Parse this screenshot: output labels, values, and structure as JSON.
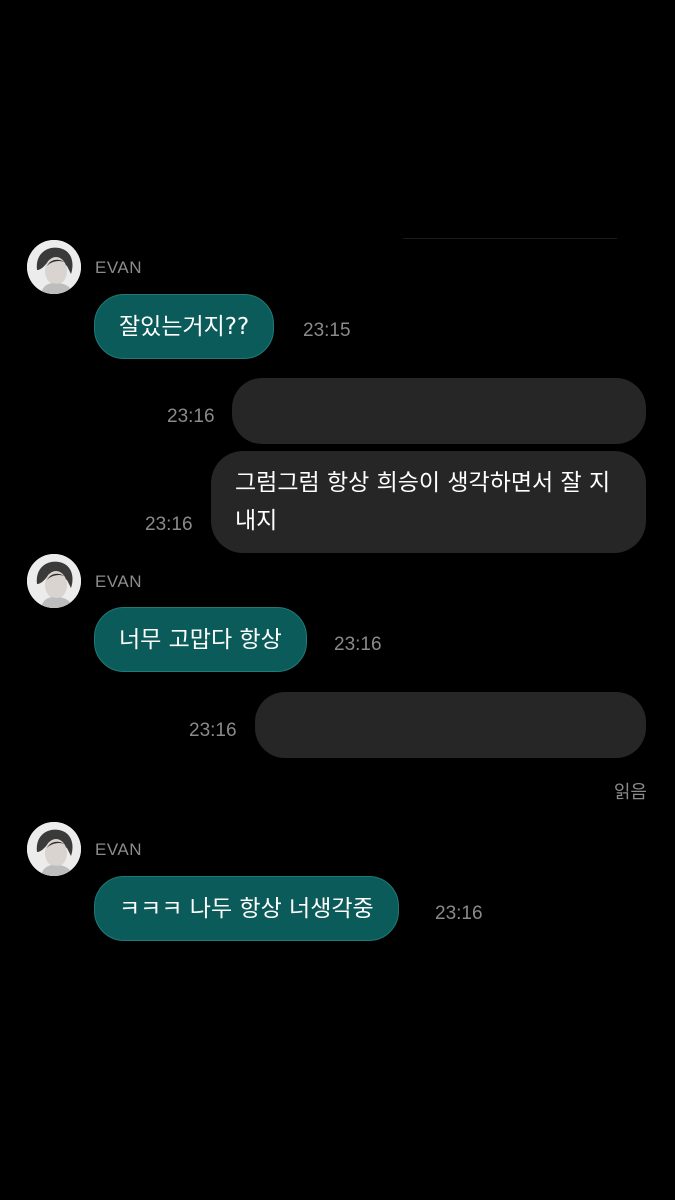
{
  "messages": {
    "m1": {
      "sender": "EVAN",
      "text": "잘있는거지??",
      "time": "23:15"
    },
    "m2": {
      "text": "",
      "time": "23:16"
    },
    "m3": {
      "text": "그럼그럼 항상 희승이 생각하면서 잘 지내지",
      "time": "23:16"
    },
    "m4": {
      "sender": "EVAN",
      "text": "너무 고맙다 항상",
      "time": "23:16"
    },
    "m5": {
      "text": "",
      "time": "23:16"
    },
    "read_receipt": "읽음",
    "m6": {
      "sender": "EVAN",
      "text": "ㅋㅋㅋ 나두 항상 너생각중",
      "time": "23:16"
    }
  },
  "colors": {
    "background": "#000000",
    "incoming_bubble": "#0b5b5a",
    "outgoing_bubble": "#262626",
    "meta_text": "#8a8a8a"
  },
  "icons": {
    "avatar": "profile-photo"
  }
}
